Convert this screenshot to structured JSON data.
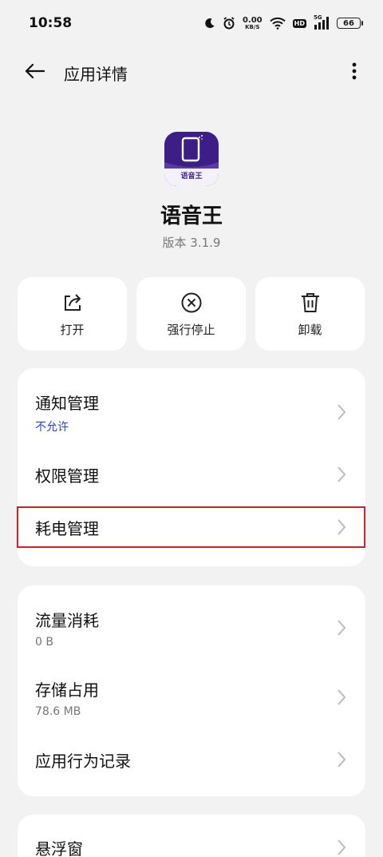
{
  "status_bar": {
    "time": "10:58",
    "net_speed_value": "0.00",
    "net_speed_unit": "KB/S",
    "hd": "HD",
    "network": "5G",
    "battery": "66",
    "icons": [
      "moon-icon",
      "alarm-icon",
      "wifi-icon",
      "signal-icon",
      "battery-icon"
    ]
  },
  "app_bar": {
    "title": "应用详情",
    "back_icon": "arrow-left-icon",
    "more_icon": "more-vertical-icon"
  },
  "app": {
    "name": "语音王",
    "version": "版本 3.1.9",
    "icon_label": "语音王",
    "icon_colors": {
      "primary": "#3d1e86",
      "secondary": "#f4f1fa"
    }
  },
  "actions": [
    {
      "label": "打开",
      "icon": "open-external-icon"
    },
    {
      "label": "强行停止",
      "icon": "force-stop-icon"
    },
    {
      "label": "卸载",
      "icon": "trash-icon"
    }
  ],
  "card1": [
    {
      "title": "通知管理",
      "subtitle": "不允许"
    },
    {
      "title": "权限管理"
    },
    {
      "title": "耗电管理",
      "highlighted": true
    }
  ],
  "card2": [
    {
      "title": "流量消耗",
      "subtitle": "0 B"
    },
    {
      "title": "存储占用",
      "subtitle": "78.6 MB"
    },
    {
      "title": "应用行为记录"
    }
  ],
  "card3": [
    {
      "title": "悬浮窗"
    }
  ],
  "colors": {
    "background": "#f2f2f2",
    "card": "#ffffff",
    "link": "#2946c8",
    "highlight_border": "#d51f26"
  }
}
